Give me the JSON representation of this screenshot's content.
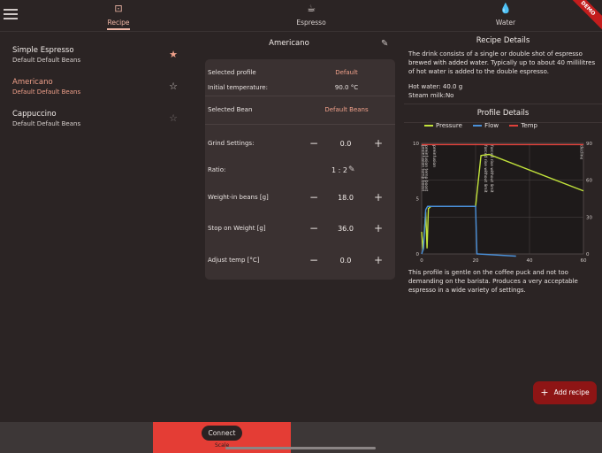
{
  "header": {
    "tabs": [
      {
        "label": "Recipe",
        "icon": "recipe-icon",
        "active": true
      },
      {
        "label": "Espresso",
        "icon": "coffee-cup-icon",
        "active": false
      },
      {
        "label": "Water",
        "icon": "water-drop-icon",
        "active": false
      }
    ],
    "demo_badge": "DEMO"
  },
  "recipes": [
    {
      "name": "Simple Espresso",
      "beans": "Default Default Beans",
      "favorite": "full"
    },
    {
      "name": "Americano",
      "beans": "Default Default Beans",
      "favorite": "outline"
    },
    {
      "name": "Cappuccino",
      "beans": "Default Default Beans",
      "favorite": "faded"
    }
  ],
  "detail": {
    "title": "Americano",
    "selected_profile_label": "Selected profile",
    "selected_profile_value": "Default",
    "initial_temp_label": "Initial temperature:",
    "initial_temp_value": "90.0 °C",
    "selected_bean_label": "Selected Bean",
    "selected_bean_value": "Default Beans",
    "grind_label": "Grind Settings:",
    "grind_value": "0.0",
    "ratio_label": "Ratio:",
    "ratio_value": "1 : 2",
    "weight_in_label": "Weight-in beans [g]",
    "weight_in_value": "18.0",
    "stop_weight_label": "Stop on Weight [g]",
    "stop_weight_value": "36.0",
    "adjust_temp_label": "Adjust temp [°C]",
    "adjust_temp_value": "0.0"
  },
  "recipe_details": {
    "heading": "Recipe Details",
    "description": "The drink consists of a single or double shot of espresso brewed with added water. Typically up to about 40 millilitres of hot water is added to the double espresso.",
    "hot_water": "Hot water: 40.0 g",
    "steam_milk": "Steam milk:No"
  },
  "profile_details": {
    "heading": "Profile Details",
    "description": "This profile is gentle on the coffee puck and not too demanding on the barista.  Produces a very acceptable espresso in a wide variety of settings."
  },
  "chart_data": {
    "type": "line",
    "title": "",
    "xlabel": "",
    "ylabel": "",
    "xlim": [
      0,
      60
    ],
    "ylim": [
      0,
      10
    ],
    "ylim_right": [
      0,
      90
    ],
    "x_ticks": [
      "0",
      "20",
      "40",
      "60"
    ],
    "y_ticks_left": [
      "0",
      "5",
      "10"
    ],
    "y_ticks_right": [
      "0",
      "30",
      "60",
      "90"
    ],
    "legend": "top",
    "grid": true,
    "colors": {
      "Pressure": "#c2e33b",
      "Flow": "#4a90d9",
      "Temp": "#e0413a"
    },
    "series": [
      {
        "name": "Pressure",
        "x": [
          0,
          0.5,
          1.5,
          2,
          2.5,
          3.5,
          20,
          22,
          25,
          60
        ],
        "y": [
          2,
          0.3,
          3.8,
          0.5,
          4.1,
          4.3,
          4.3,
          8.9,
          9,
          5.7
        ]
      },
      {
        "name": "Flow",
        "x": [
          0,
          0.7,
          1.5,
          2.2,
          20,
          20.5,
          35
        ],
        "y": [
          0,
          0.5,
          4,
          4.3,
          4.3,
          0,
          -0.2
        ]
      },
      {
        "name": "Temp",
        "x": [
          0,
          60
        ],
        "y": [
          89,
          89
        ]
      }
    ],
    "annotations": [
      "preinfusion temp boost",
      "preinfusion temp boost",
      "preinfusion",
      "forced rise without limit",
      "forced rise without limit",
      "decline"
    ]
  },
  "actions": {
    "add_recipe": "Add recipe",
    "connect": "Connect",
    "scale": "Scale"
  }
}
